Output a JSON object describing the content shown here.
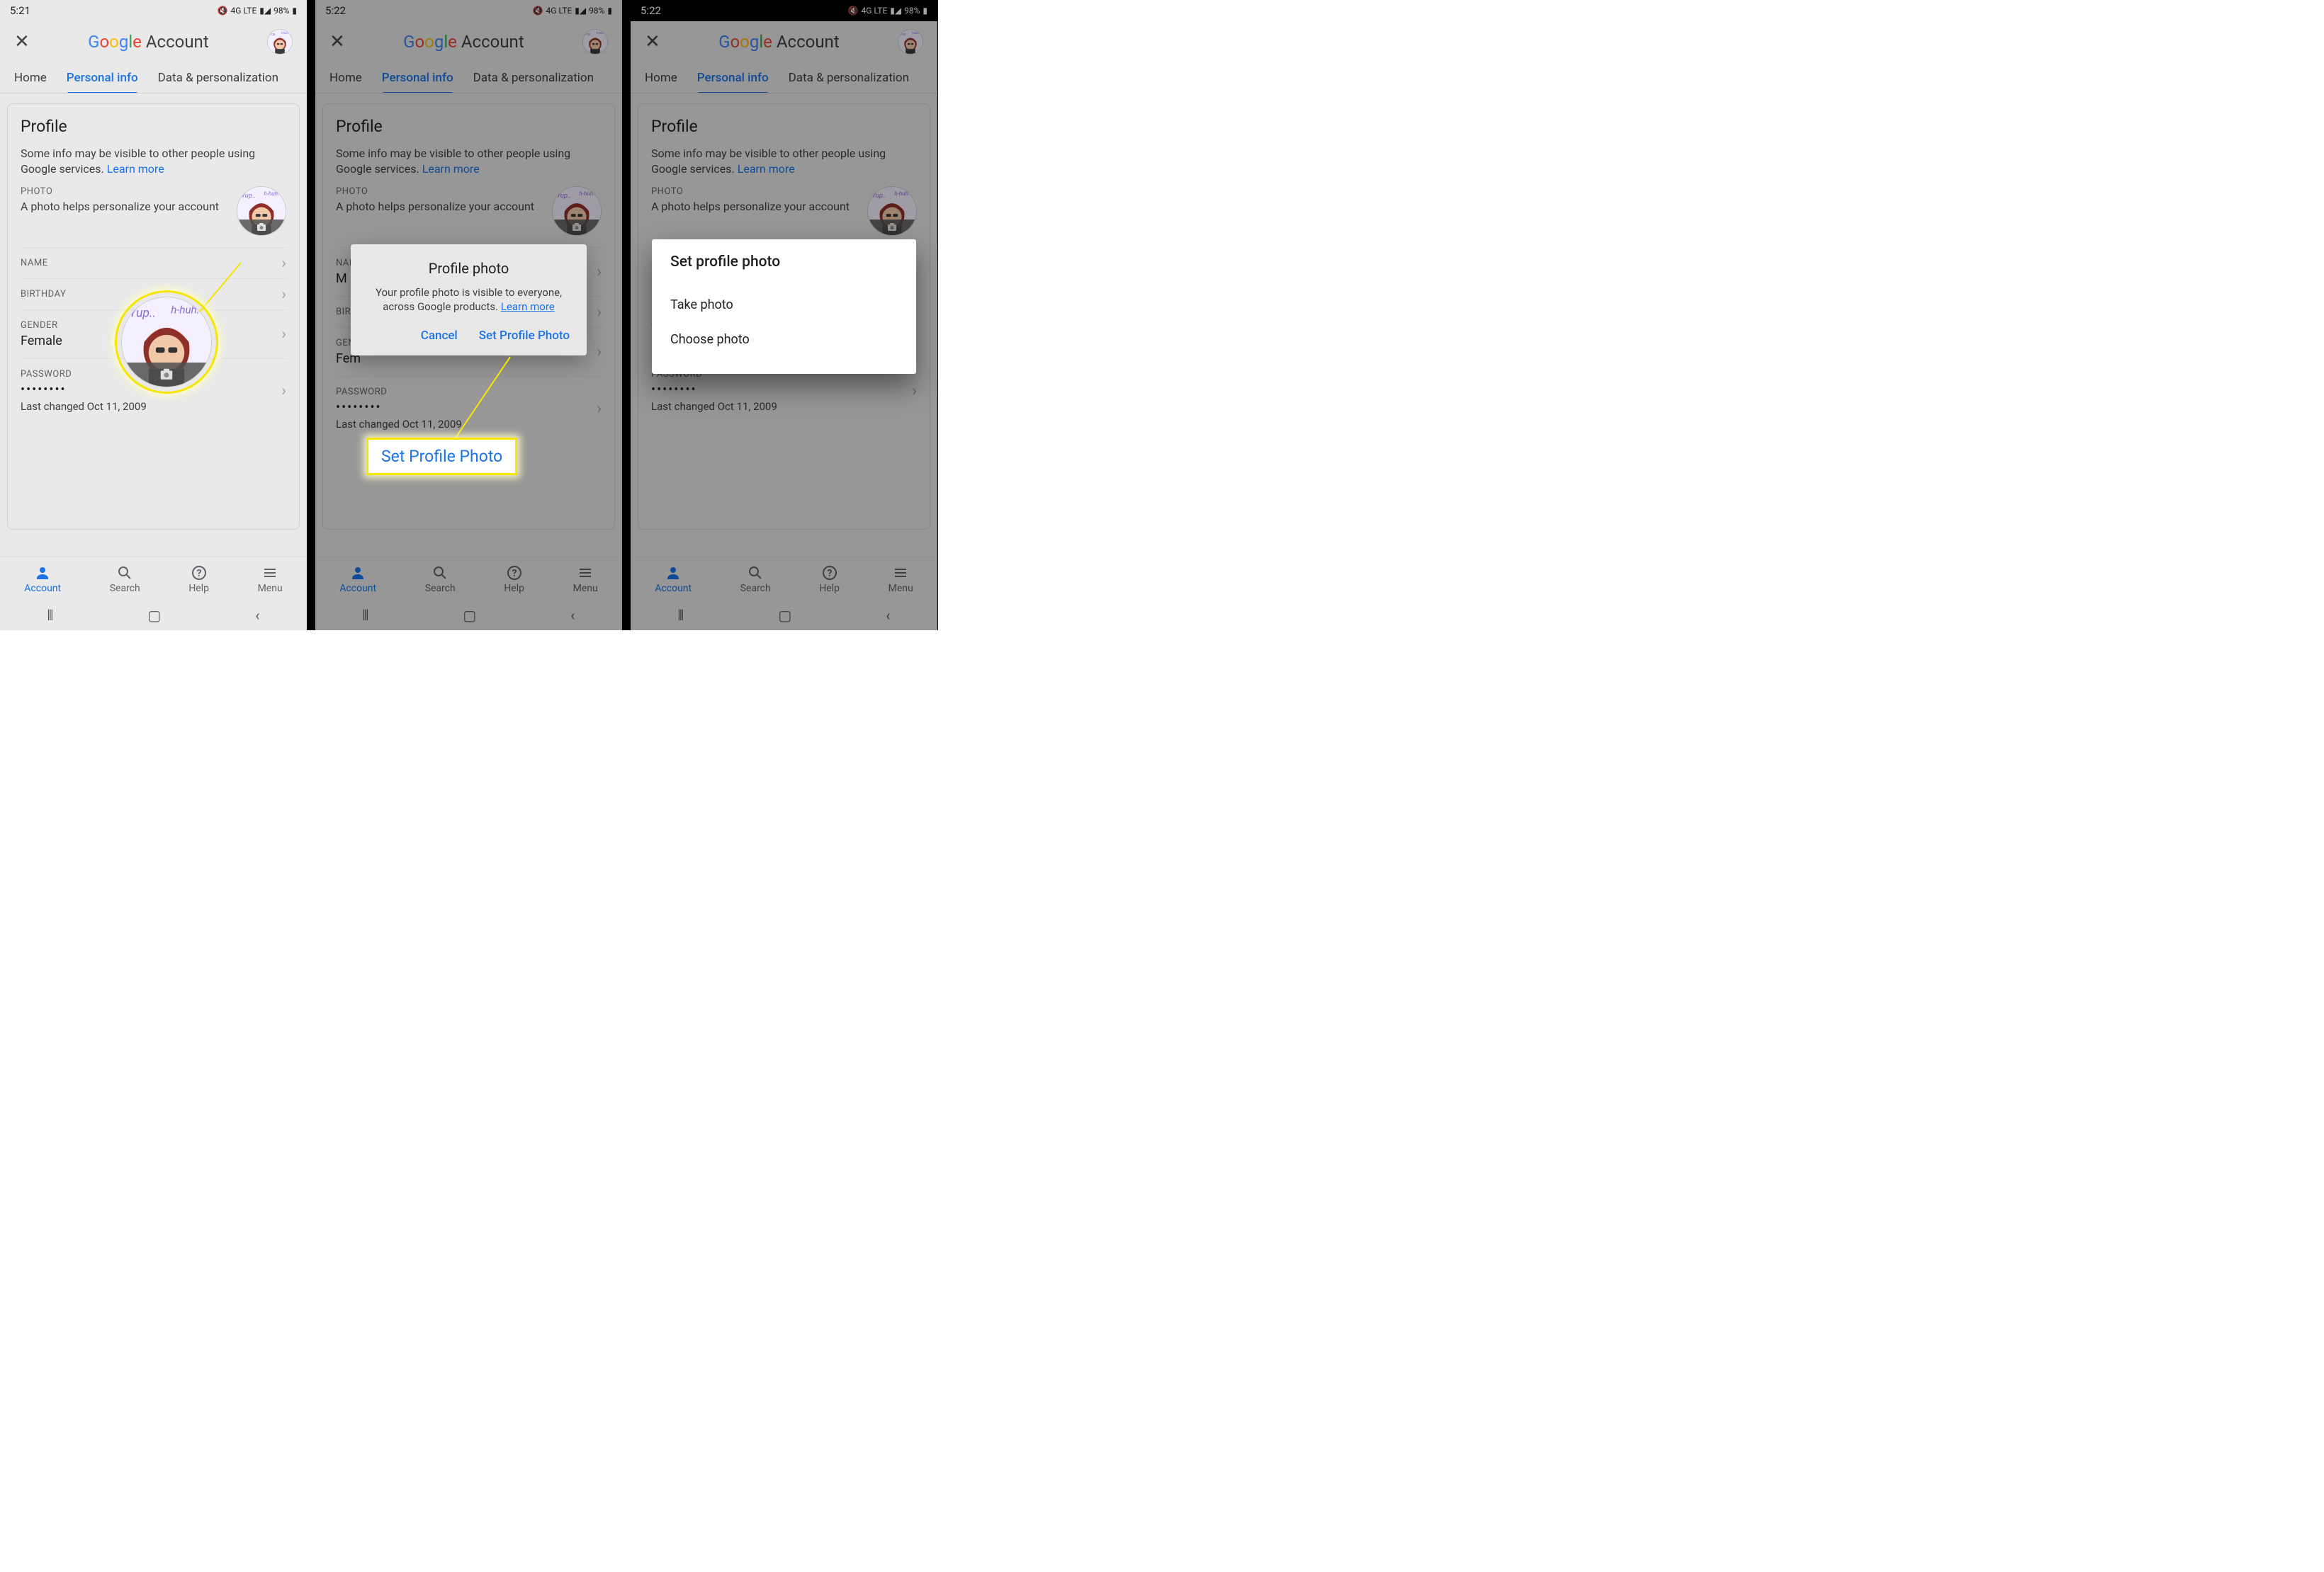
{
  "status": {
    "time1": "5:21",
    "time2": "5:22",
    "time3": "5:22",
    "lte": "4G LTE",
    "battery": "98%"
  },
  "header": {
    "brand_suffix": "Account"
  },
  "tabs": {
    "home": "Home",
    "personal": "Personal info",
    "data": "Data & personalization"
  },
  "profile": {
    "title": "Profile",
    "intro": "Some info may be visible to other people using Google services. ",
    "learn": "Learn more",
    "photo_label": "PHOTO",
    "photo_desc": "A photo helps personalize your account",
    "name_label": "NAME",
    "name_value_masked": "M",
    "birthday_label": "BIRTHDAY",
    "gender_label": "GENDER",
    "gender_value": "Female",
    "gender_value_masked": "Fem",
    "password_label": "PASSWORD",
    "password_changed": "Last changed Oct 11, 2009"
  },
  "bottomnav": {
    "account": "Account",
    "search": "Search",
    "help": "Help",
    "menu": "Menu"
  },
  "dialog1": {
    "title": "Profile photo",
    "body": "Your profile photo is visible to everyone, across Google products. ",
    "learn": "Learn more",
    "cancel": "Cancel",
    "set": "Set Profile Photo"
  },
  "dialog2": {
    "title": "Set profile photo",
    "opt1": "Take photo",
    "opt2": "Choose photo"
  },
  "callout_set": "Set Profile Photo"
}
